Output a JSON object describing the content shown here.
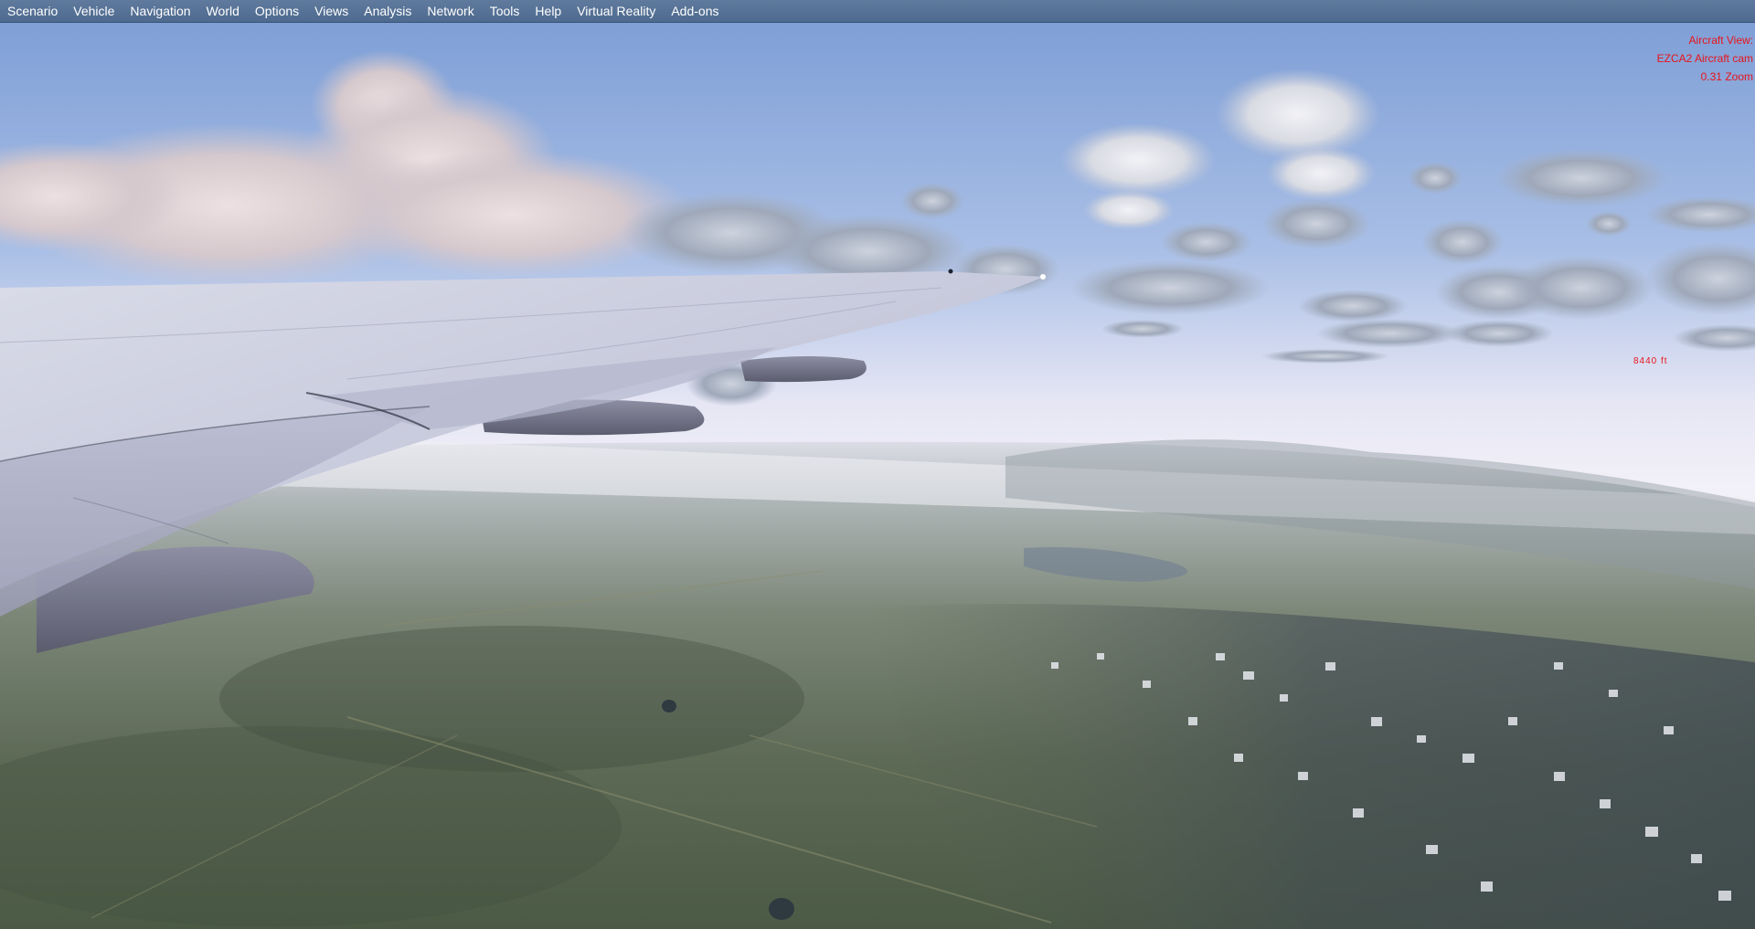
{
  "menu": {
    "items": [
      {
        "label": "Scenario"
      },
      {
        "label": "Vehicle"
      },
      {
        "label": "Navigation"
      },
      {
        "label": "World"
      },
      {
        "label": "Options"
      },
      {
        "label": "Views"
      },
      {
        "label": "Analysis"
      },
      {
        "label": "Network"
      },
      {
        "label": "Tools"
      },
      {
        "label": "Help"
      },
      {
        "label": "Virtual Reality"
      },
      {
        "label": "Add-ons"
      }
    ]
  },
  "hud": {
    "view_line": "Aircraft View:",
    "camera_line": "EZCA2 Aircraft cam",
    "zoom_line": "0.31 Zoom"
  },
  "scenery": {
    "altitude_tag": "8440 ft"
  },
  "colors": {
    "menubar": "#56729a",
    "hud_text": "#e8141b",
    "sky_top": "#7f9fd6",
    "ground": "#4f5c4e"
  }
}
